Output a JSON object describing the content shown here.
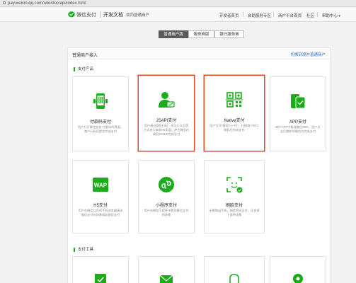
{
  "browser": {
    "url": "pay.weixin.qq.com/wiki/doc/api/index.html"
  },
  "header": {
    "brand": "微信支付",
    "docs": "开发文档",
    "docs_sub": "境内普通商户",
    "nav": [
      "开发者首页",
      "自助服务专区",
      "商户平台首页",
      "社区",
      "帮助中心"
    ]
  },
  "segments": [
    {
      "label": "普通商户版",
      "active": true
    },
    {
      "label": "服务商版",
      "active": false
    },
    {
      "label": "银行服务商",
      "active": false
    }
  ],
  "card": {
    "title": "普通商户接入",
    "link": "切换到境外普通商户"
  },
  "sections": {
    "products": "支付产品",
    "tools": "支付工具"
  },
  "products": [
    {
      "name": "付款码支付",
      "desc": "用户打开微信钱包-付款码的界面，商户扫码后提交完成支付",
      "icon": "barcode-phone-icon"
    },
    {
      "name": "JSAPI支付",
      "desc": "用户通过微信扫码、关注公众号等方式进入商家H5页面，并在微信内调用JSSDK完成支付",
      "icon": "person-payment-icon"
    },
    {
      "name": "Native支付",
      "desc": "用户打开\"微信扫一扫\"，扫描商户的二维码后完成支付",
      "icon": "qrcode-icon"
    },
    {
      "name": "APP支付",
      "desc": "商户APP中集成微信SDK，用户点击后跳转到微信内完成支付",
      "icon": "app-phone-icon"
    },
    {
      "name": "H5支付",
      "desc": "用户在微信以外的手机浏览器请求微信支付的场景唤起微信支付",
      "icon": "wap-icon"
    },
    {
      "name": "小程序支付",
      "desc": "用户在微信小程序中使用微信支付的场景",
      "icon": "miniprogram-icon"
    },
    {
      "name": "刷脸支付",
      "desc": "无需掏出手机，刷脸完成支付，适合线下各种场景",
      "icon": "face-scan-icon"
    }
  ],
  "colors": {
    "green": "#1aad19",
    "highlight": "#e04a23",
    "link": "#2b6fbf"
  }
}
